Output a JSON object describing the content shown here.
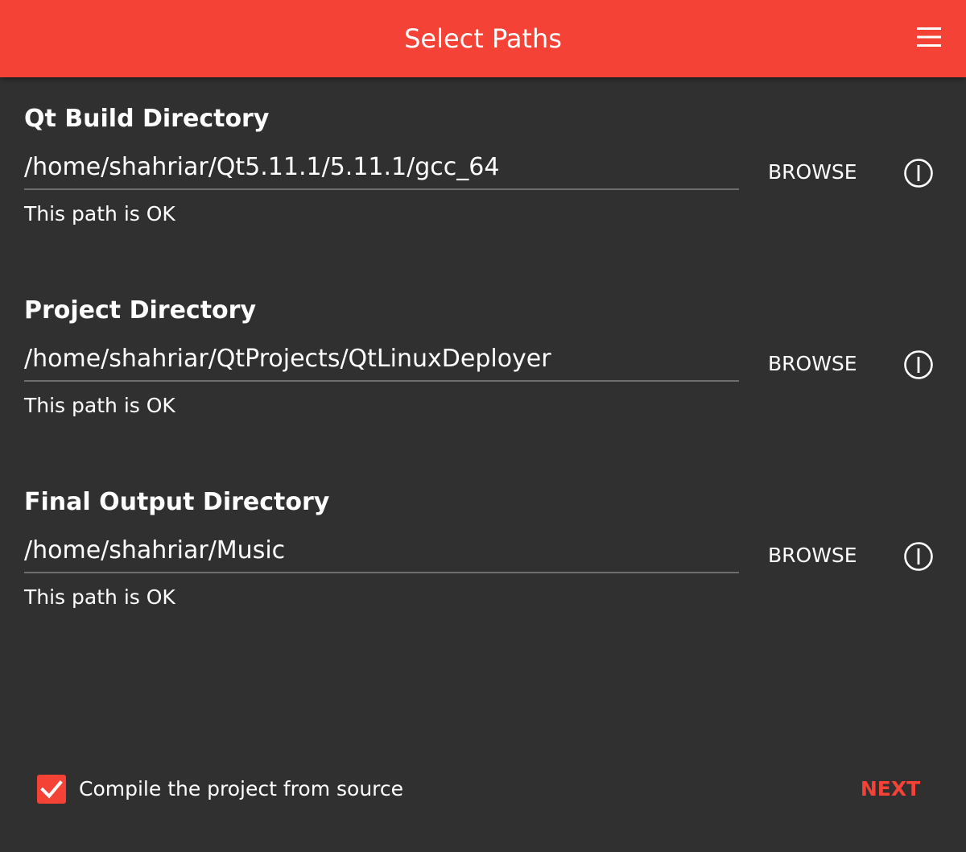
{
  "app": {
    "title": "Select Paths",
    "accent_color": "#f44336",
    "background_color": "#303030"
  },
  "header": {
    "menu_icon": "hamburger-menu-icon"
  },
  "sections": [
    {
      "title": "Qt Build Directory",
      "path": "/home/shahriar/Qt5.11.1/5.11.1/gcc_64",
      "browse_label": "BROWSE",
      "info_icon": "info-icon",
      "status": "This path is OK"
    },
    {
      "title": "Project Directory",
      "path": "/home/shahriar/QtProjects/QtLinuxDeployer",
      "browse_label": "BROWSE",
      "info_icon": "info-icon",
      "status": "This path is OK"
    },
    {
      "title": "Final Output Directory",
      "path": "/home/shahriar/Music",
      "browse_label": "BROWSE",
      "info_icon": "info-icon",
      "status": "This path is OK"
    }
  ],
  "footer": {
    "compile_checkbox_checked": true,
    "compile_label": "Compile the project from source",
    "next_label": "NEXT"
  }
}
